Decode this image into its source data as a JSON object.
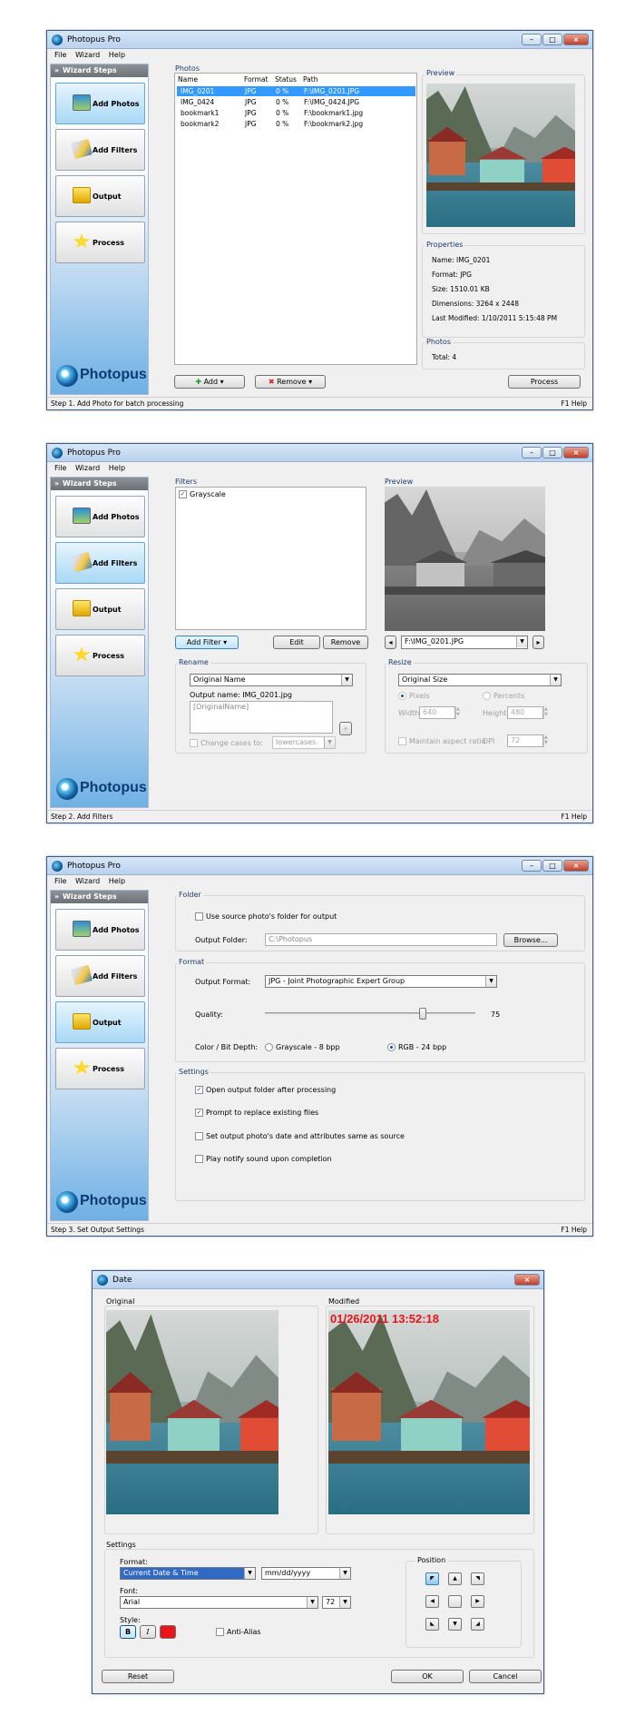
{
  "app_title": "Photopus Pro",
  "menu": [
    "File",
    "Wizard",
    "Help"
  ],
  "sidebar": {
    "header": "Wizard Steps",
    "steps": [
      "Add Photos",
      "Add Filters",
      "Output",
      "Process"
    ],
    "logo": "Photopus"
  },
  "screen1": {
    "photos_label": "Photos",
    "columns": [
      "Name",
      "Format",
      "Status",
      "Path"
    ],
    "rows": [
      {
        "name": "IMG_0201",
        "format": "JPG",
        "status": "0 %",
        "path": "F:\\IMG_0201.JPG"
      },
      {
        "name": "IMG_0424",
        "format": "JPG",
        "status": "0 %",
        "path": "F:\\IMG_0424.JPG"
      },
      {
        "name": "bookmark1",
        "format": "JPG",
        "status": "0 %",
        "path": "F:\\bookmark1.jpg"
      },
      {
        "name": "bookmark2",
        "format": "JPG",
        "status": "0 %",
        "path": "F:\\bookmark2.jpg"
      }
    ],
    "preview_label": "Preview",
    "properties_label": "Properties",
    "properties": [
      "Name: IMG_0201",
      "Format: JPG",
      "Size: 1510.01 KB",
      "Dimensions: 3264 x 2448",
      "Last Modified: 1/10/2011 5:15:48 PM"
    ],
    "photos_group_label": "Photos",
    "total": "Total: 4",
    "add_label": "Add",
    "remove_label": "Remove",
    "process_label": "Process",
    "status": "Step 1. Add Photo for batch processing",
    "help": "F1 Help"
  },
  "screen2": {
    "filters_label": "Filters",
    "filter_item": "Grayscale",
    "preview_label": "Preview",
    "preview_file": "F:\\IMG_0201.JPG",
    "add_filter_label": "Add Filter",
    "edit_label": "Edit",
    "remove_label": "Remove",
    "rename_label": "Rename",
    "rename_option": "Original Name",
    "output_name": "Output name: IMG_0201.jpg",
    "rename_placeholder": "[OriginalName]",
    "change_cases": "Change cases to:",
    "cases_option": "lowercases",
    "resize_label": "Resize",
    "resize_option": "Original Size",
    "pixels": "Pixels",
    "percents": "Percents",
    "width_label": "Width:",
    "width_value": "640",
    "height_label": "Height:",
    "height_value": "480",
    "maintain": "Maintain aspect ratio",
    "dpi_label": "DPI",
    "dpi_value": "72",
    "status": "Step 2. Add Filters",
    "help": "F1 Help"
  },
  "screen3": {
    "folder_label": "Folder",
    "use_source": "Use source photo's folder for output",
    "output_folder_label": "Output Folder:",
    "output_folder_value": "C:\\Photopus",
    "browse_label": "Browse...",
    "format_label": "Format",
    "output_format_label": "Output Format:",
    "output_format_value": "JPG - Joint Photographic Expert Group",
    "quality_label": "Quality:",
    "quality_value": "75",
    "quality_fraction": 0.75,
    "color_depth_label": "Color / Bit Depth:",
    "gray_option": "Grayscale - 8 bpp",
    "rgb_option": "RGB - 24 bpp",
    "settings_label": "Settings",
    "settings": [
      {
        "label": "Open output folder after processing",
        "checked": true
      },
      {
        "label": "Prompt to replace existing files",
        "checked": true
      },
      {
        "label": "Set output photo's date and attributes same as source",
        "checked": false
      },
      {
        "label": "Play notify sound upon completion",
        "checked": false
      }
    ],
    "status": "Step 3. Set Output Settings",
    "help": "F1 Help"
  },
  "date_dialog": {
    "title": "Date",
    "original_label": "Original",
    "modified_label": "Modified",
    "stamp": "01/26/2011 13:52:18",
    "stamp_color": "#e8141a",
    "settings_label": "Settings",
    "format_label": "Format:",
    "format_value": "Current Date & Time",
    "date_format": "mm/dd/yyyy",
    "font_label": "Font:",
    "font_value": "Arial",
    "font_size": "72",
    "style_label": "Style:",
    "bold": "B",
    "italic": "I",
    "color": "#e8141a",
    "anti_alias": "Anti-Alias",
    "position_label": "Position",
    "reset_label": "Reset",
    "ok_label": "OK",
    "cancel_label": "Cancel"
  },
  "icons": [
    "app-icon",
    "minimize-icon",
    "maximize-icon",
    "close-icon",
    "add-icon",
    "remove-icon",
    "photo-icon",
    "filter-icon",
    "output-icon",
    "process-icon"
  ]
}
